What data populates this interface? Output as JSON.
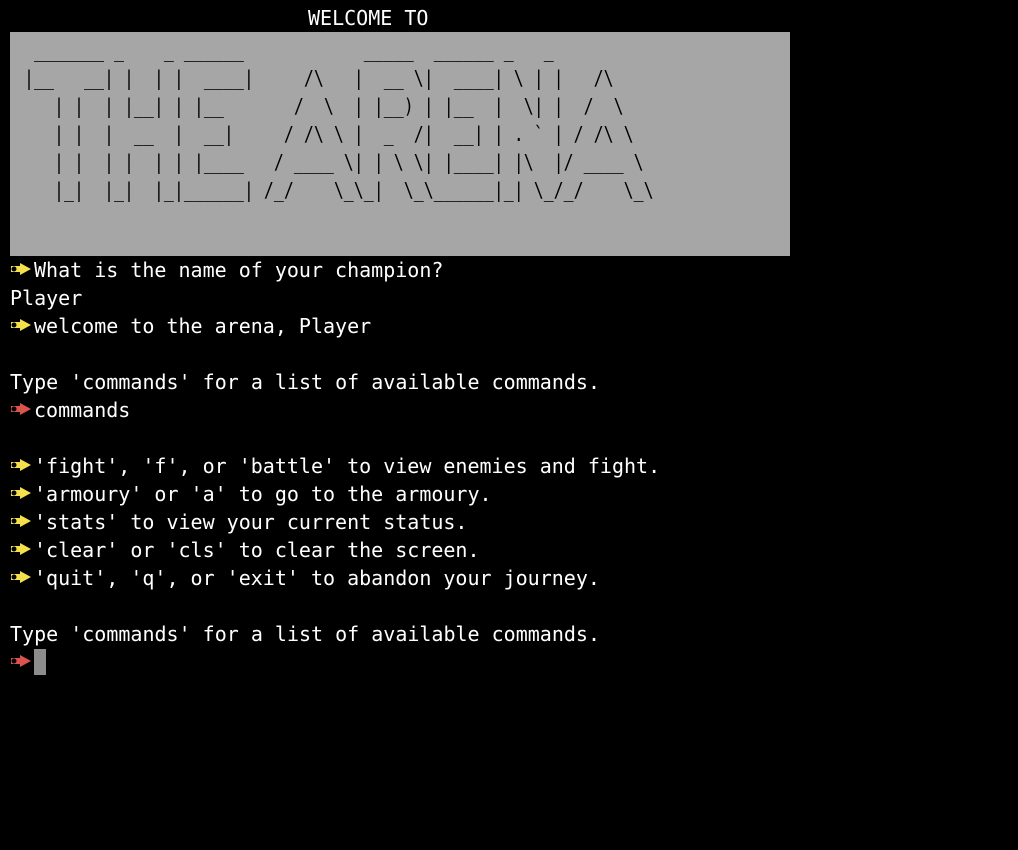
{
  "welcome_heading": "WELCOME TO",
  "banner_art": " _______ _    _ ______            _____  ______ _   _\n|__   __| |  | |  ____|     /\\   |  __ \\|  ____| \\ | |   /\\\n   | |  | |__| | |__       /  \\  | |__) | |__  |  \\| |  /  \\\n   | |  |  __  |  __|     / /\\ \\ |  _  /|  __| | . ` | / /\\ \\\n   | |  | |  | | |____   / ____ \\| | \\ \\| |____| |\\  |/ ____ \\\n   |_|  |_|  |_|______| /_/    \\_\\_|  \\_\\______|_| \\_/_/    \\_\\",
  "colors": {
    "background": "#000000",
    "text": "#ffffff",
    "banner_bg": "#a6a6a6",
    "banner_text": "#000000",
    "prompt_output": "#f4e04d",
    "prompt_input": "#d9534f",
    "cursor": "#8c8c8c"
  },
  "icons": {
    "output_prompt": "yellow-hand-arrow-icon",
    "input_prompt": "red-hand-arrow-icon"
  },
  "lines": {
    "q_name": "What is the name of your champion?",
    "answer_name": "Player",
    "welcome_msg": "welcome to the arena, Player",
    "hint_1": "Type 'commands' for a list of available commands.",
    "input_1": "commands",
    "cmd_fight": "'fight', 'f', or 'battle' to view enemies and fight.",
    "cmd_armoury": "'armoury' or 'a' to go to the armoury.",
    "cmd_stats": "'stats' to view your current status.",
    "cmd_clear": "'clear' or 'cls' to clear the screen.",
    "cmd_quit": "'quit', 'q', or 'exit' to abandon your journey.",
    "hint_2": "Type 'commands' for a list of available commands."
  }
}
